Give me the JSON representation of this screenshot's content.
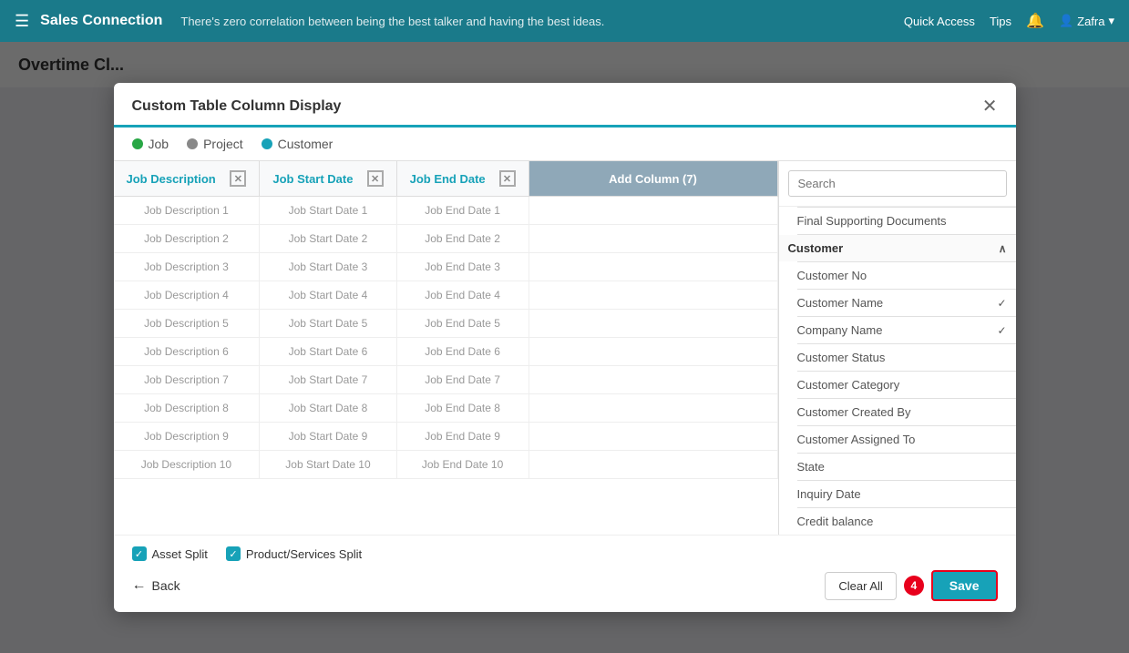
{
  "nav": {
    "hamburger": "☰",
    "brand": "Sales Connection",
    "tagline": "There's zero correlation between being the best talker and having the best ideas.",
    "quickAccess": "Quick Access",
    "tips": "Tips",
    "bell": "🔔",
    "user": "Zafra",
    "chevron": "▾"
  },
  "modal": {
    "title": "Custom Table Column Display",
    "closeBtn": "✕",
    "tabs": [
      {
        "label": "Job",
        "color": "green"
      },
      {
        "label": "Project",
        "color": "gray"
      },
      {
        "label": "Customer",
        "color": "blue"
      }
    ],
    "columns": [
      {
        "label": "Job Description",
        "id": "job-description"
      },
      {
        "label": "Job Start Date",
        "id": "job-start-date"
      },
      {
        "label": "Job End Date",
        "id": "job-end-date"
      }
    ],
    "addColumnLabel": "Add Column (7)",
    "rows": [
      {
        "c1": "Job Description 1",
        "c2": "Job Start Date 1",
        "c3": "Job End Date 1"
      },
      {
        "c1": "Job Description 2",
        "c2": "Job Start Date 2",
        "c3": "Job End Date 2"
      },
      {
        "c1": "Job Description 3",
        "c2": "Job Start Date 3",
        "c3": "Job End Date 3"
      },
      {
        "c1": "Job Description 4",
        "c2": "Job Start Date 4",
        "c3": "Job End Date 4"
      },
      {
        "c1": "Job Description 5",
        "c2": "Job Start Date 5",
        "c3": "Job End Date 5"
      },
      {
        "c1": "Job Description 6",
        "c2": "Job Start Date 6",
        "c3": "Job End Date 6"
      },
      {
        "c1": "Job Description 7",
        "c2": "Job Start Date 7",
        "c3": "Job End Date 7"
      },
      {
        "c1": "Job Description 8",
        "c2": "Job Start Date 8",
        "c3": "Job End Date 8"
      },
      {
        "c1": "Job Description 9",
        "c2": "Job Start Date 9",
        "c3": "Job End Date 9"
      },
      {
        "c1": "Job Description 10",
        "c2": "Job Start Date 10",
        "c3": "Job End Date 10"
      }
    ],
    "rightPanel": {
      "searchPlaceholder": "Search",
      "finalDocsLabel": "Final Supporting Documents",
      "sectionLabel": "Customer",
      "items": [
        {
          "label": "Customer No",
          "checked": false
        },
        {
          "label": "Customer Name",
          "checked": true
        },
        {
          "label": "Company Name",
          "checked": true
        },
        {
          "label": "Customer Status",
          "checked": false
        },
        {
          "label": "Customer Category",
          "checked": false
        },
        {
          "label": "Customer Created By",
          "checked": false
        },
        {
          "label": "Customer Assigned To",
          "checked": false
        },
        {
          "label": "State",
          "checked": false
        },
        {
          "label": "Inquiry Date",
          "checked": false
        },
        {
          "label": "Credit balance",
          "checked": false
        }
      ]
    },
    "checkboxes": [
      {
        "label": "Asset Split",
        "checked": true
      },
      {
        "label": "Product/Services Split",
        "checked": true
      }
    ],
    "backLabel": "Back",
    "clearAllLabel": "Clear All",
    "stepBadge": "4",
    "saveLabel": "Save"
  },
  "colors": {
    "accent": "#17a2b8",
    "danger": "#e8001c"
  }
}
